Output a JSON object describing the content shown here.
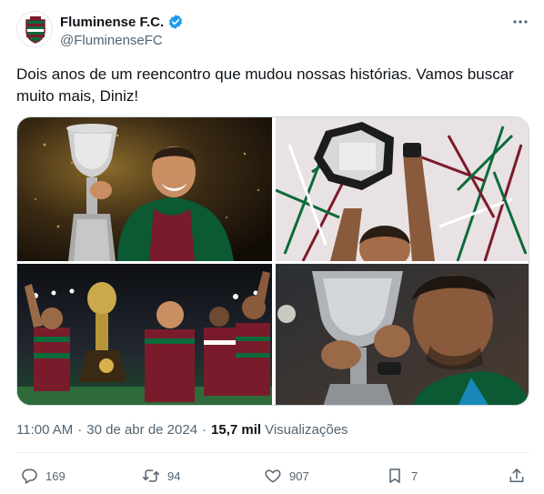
{
  "account": {
    "display_name": "Fluminense F.C.",
    "handle": "@FluminenseFC",
    "verified": true
  },
  "tweet": {
    "text": "Dois anos de um reencontro que mudou nossas histórias. Vamos buscar muito mais, Diniz!",
    "time": "11:00 AM",
    "separator": "·",
    "date": "30 de abr de 2024",
    "views_count": "15,7 mil",
    "views_label": "Visualizações"
  },
  "actions": {
    "replies": "169",
    "retweets": "94",
    "likes": "907",
    "bookmarks": "7"
  },
  "media": {
    "images": [
      {
        "alt": "coach-holding-trophy"
      },
      {
        "alt": "trophy-raised-confetti"
      },
      {
        "alt": "team-celebrating-with-trophy"
      },
      {
        "alt": "coach-kissing-trophy"
      }
    ]
  },
  "colors": {
    "text_primary": "#0f1419",
    "text_secondary": "#536471",
    "verified": "#1d9bf0",
    "border": "#cfd9de",
    "club_maroon": "#7a1b2c",
    "club_green": "#0b6b3a"
  },
  "icons": [
    "more-icon",
    "verified-badge-icon",
    "reply-icon",
    "retweet-icon",
    "like-icon",
    "bookmark-icon",
    "share-icon"
  ]
}
